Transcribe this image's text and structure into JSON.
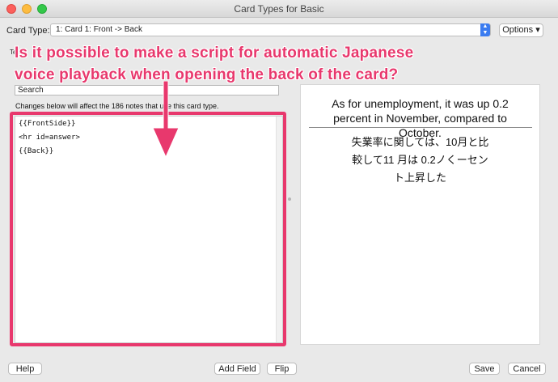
{
  "window": {
    "title": "Card Types for Basic"
  },
  "header": {
    "card_type_label": "Card Type:",
    "card_type_value": "1: Card 1: Front -> Back",
    "options_label": "Options ▾"
  },
  "editor": {
    "tab_fragment": "Te",
    "search_placeholder": "Search",
    "notice": "Changes below will affect the 186 notes that use this card type.",
    "code_lines": [
      "{{FrontSide}}",
      "<hr id=answer>",
      "{{Back}}"
    ]
  },
  "preview": {
    "front_text": "As for unemployment, it was up 0.2 percent in November, compared to October.",
    "back_text": "失業率に関しては、10月と比較して11 月は 0.2ノくーセント上昇した"
  },
  "annotation": {
    "line1": "Is it possible to make a script for automatic Japanese",
    "line2": "voice playback when opening the back of the card?",
    "color": "#e8386d"
  },
  "footer": {
    "help_label": "Help",
    "add_field_label": "Add Field",
    "flip_label": "Flip",
    "save_label": "Save",
    "cancel_label": "Cancel"
  }
}
